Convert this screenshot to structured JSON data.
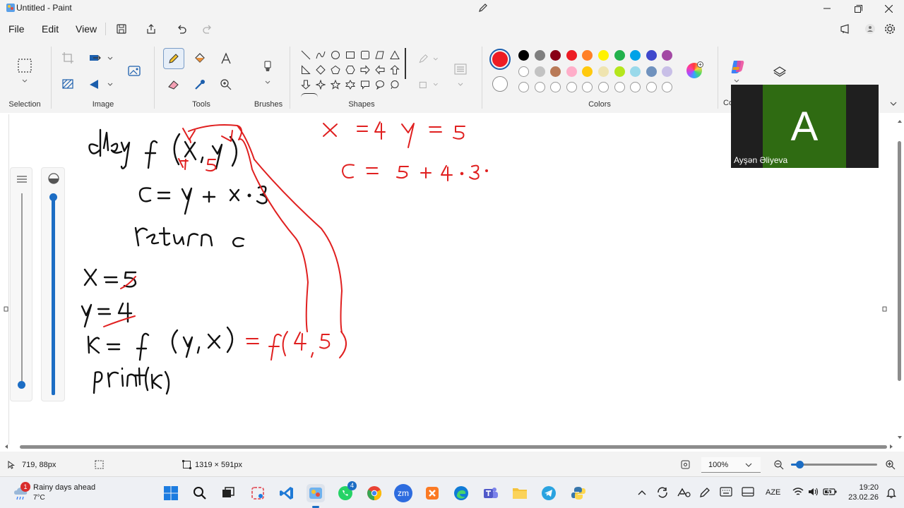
{
  "window": {
    "title": "Untitled - Paint"
  },
  "menu": {
    "file": "File",
    "edit": "Edit",
    "view": "View"
  },
  "ribbon": {
    "selection_label": "Selection",
    "image_label": "Image",
    "tools_label": "Tools",
    "brushes_label": "Brushes",
    "shapes_label": "Shapes",
    "colors_label": "Colors",
    "copilot_label": "Co"
  },
  "colors": {
    "primary": "#ed1c24",
    "secondary": "#ffffff",
    "palette_row1": [
      "#000000",
      "#7f7f7f",
      "#880015",
      "#ed1c24",
      "#ff7f27",
      "#fff200",
      "#22b14c",
      "#00a2e8",
      "#3f48cc",
      "#a349a4"
    ],
    "palette_row2": [
      "#ffffff",
      "#c3c3c3",
      "#b97a57",
      "#ffaec9",
      "#ffc90e",
      "#efe4b0",
      "#b5e61d",
      "#99d9ea",
      "#7092be",
      "#c8bfe7"
    ],
    "palette_row3_count": 10
  },
  "video": {
    "initial": "A",
    "name": "Ayşən Əliyeva"
  },
  "status": {
    "cursor_pos": "719, 88px",
    "canvas_size": "1319 × 591px",
    "zoom": "100%",
    "zoom_level": 0.1
  },
  "taskbar": {
    "weather_title": "Rainy days ahead",
    "weather_temp": "7°C",
    "weather_badge": "1",
    "whatsapp_badge": "4",
    "zoom_app_label": "zm",
    "language": "AZE",
    "time": "19:20",
    "date": "23.02.26"
  }
}
